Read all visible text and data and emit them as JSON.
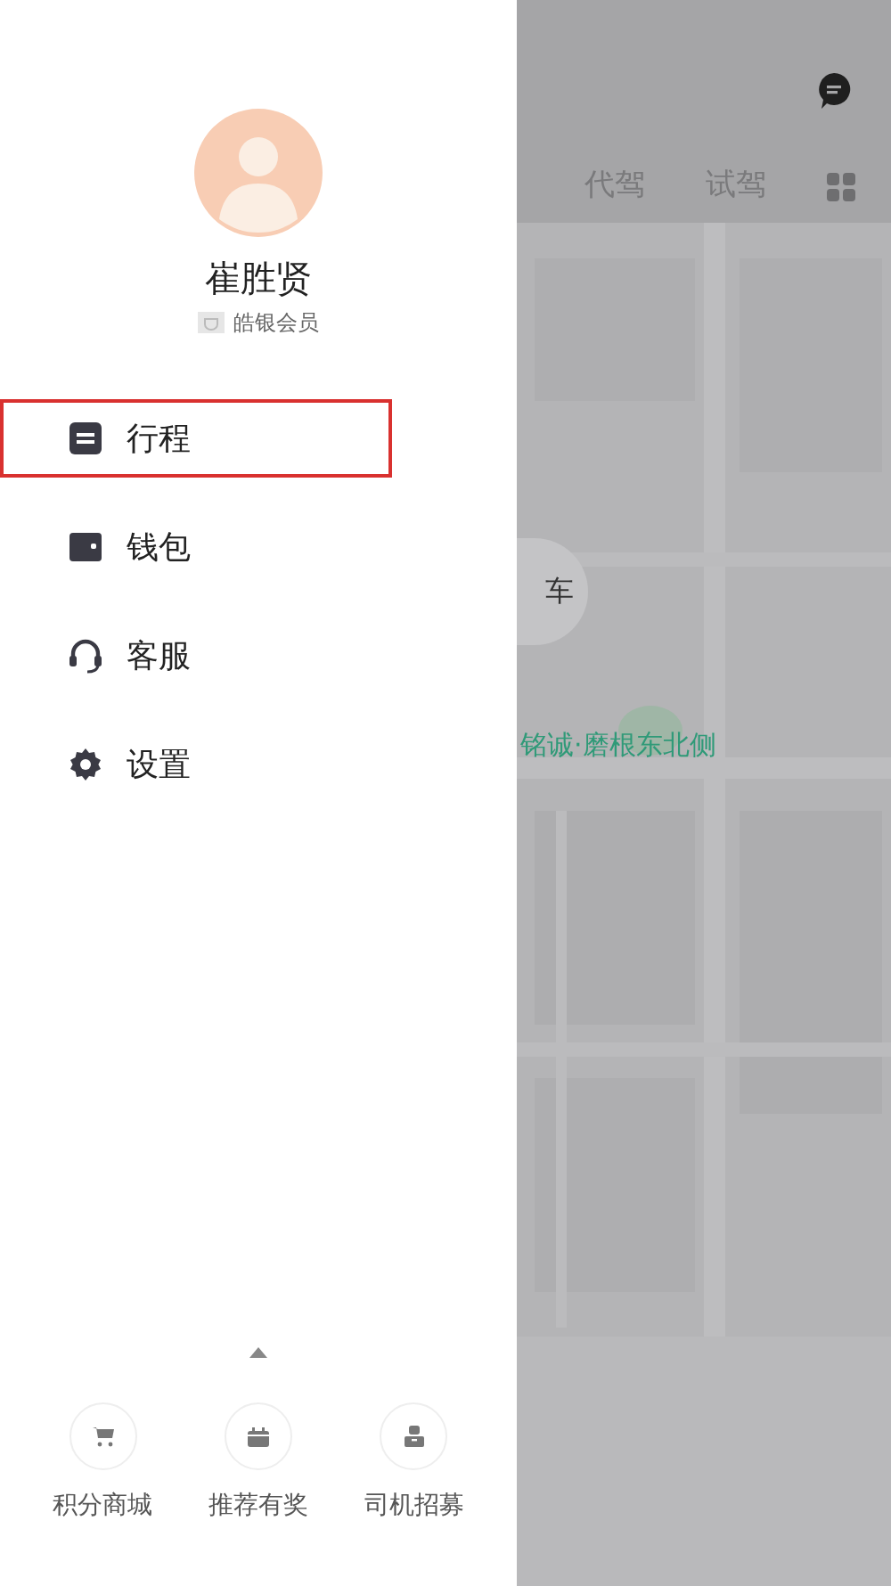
{
  "drawer": {
    "profile": {
      "name": "崔胜贤",
      "membership": "皓银会员"
    },
    "menu": [
      {
        "kind": "trips",
        "label": "行程",
        "highlighted": true
      },
      {
        "kind": "wallet",
        "label": "钱包",
        "highlighted": false
      },
      {
        "kind": "support",
        "label": "客服",
        "highlighted": false
      },
      {
        "kind": "settings",
        "label": "设置",
        "highlighted": false
      }
    ],
    "shortcuts": [
      {
        "kind": "cart",
        "label": "积分商城"
      },
      {
        "kind": "gift",
        "label": "推荐有奖"
      },
      {
        "kind": "driver",
        "label": "司机招募"
      }
    ]
  },
  "background": {
    "tabs": [
      {
        "label": "代驾"
      },
      {
        "label": "试驾"
      }
    ],
    "pickup_bubble": "车",
    "pickup_label": "铭诚·磨根东北侧"
  }
}
